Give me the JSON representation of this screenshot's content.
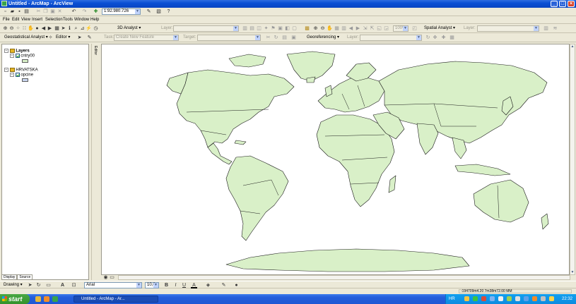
{
  "window": {
    "title": "Untitled - ArcMap - ArcView",
    "controls": [
      "_",
      "□",
      "×"
    ]
  },
  "toolbar_standard": {
    "scale": "1:92.980.726"
  },
  "menu": {
    "items": [
      "File",
      "Edit",
      "View",
      "Insert",
      "Selection",
      "Tools",
      "Window",
      "Help"
    ]
  },
  "toolbar_3d": {
    "analyst_label": "3D Analyst",
    "layer_label": "Layer:",
    "spatial_label": "Spatial Analyst",
    "spatial_layer_label": "Layer:",
    "zoom_value": "100%"
  },
  "toolbar_editor": {
    "geostat_label": "Geostatistical Analyst",
    "editor_label": "Editor",
    "task_label": "Task:",
    "task_value": "Create New Feature",
    "target_label": "Target:",
    "georef_label": "Georeferencing",
    "georef_layer_label": "Layer:"
  },
  "toc": {
    "groups": [
      {
        "name": "Layers",
        "layer": "cntry00",
        "swatch": "#d9f0c8"
      },
      {
        "name": "HRVATSKA",
        "layer": "opcine",
        "swatch": "#c9d6f0"
      }
    ],
    "tabs": [
      "Display",
      "Source"
    ]
  },
  "editor_strip": {
    "label": "Editor"
  },
  "map": {
    "background": "#ffffff",
    "land_color": "#d9f0c8",
    "outline_color": "#1a1a1a"
  },
  "drawing": {
    "menu_label": "Drawing",
    "font": "Arial",
    "size": "10,0",
    "bold": "B",
    "italic": "I",
    "underline": "U"
  },
  "status": {
    "coords": "-194709m4.20  7m38m72.00 MM"
  },
  "taskbar": {
    "start": "start",
    "window_item": "Untitled - ArcMap - Ar...",
    "language": "HR",
    "clock": "22:32"
  }
}
